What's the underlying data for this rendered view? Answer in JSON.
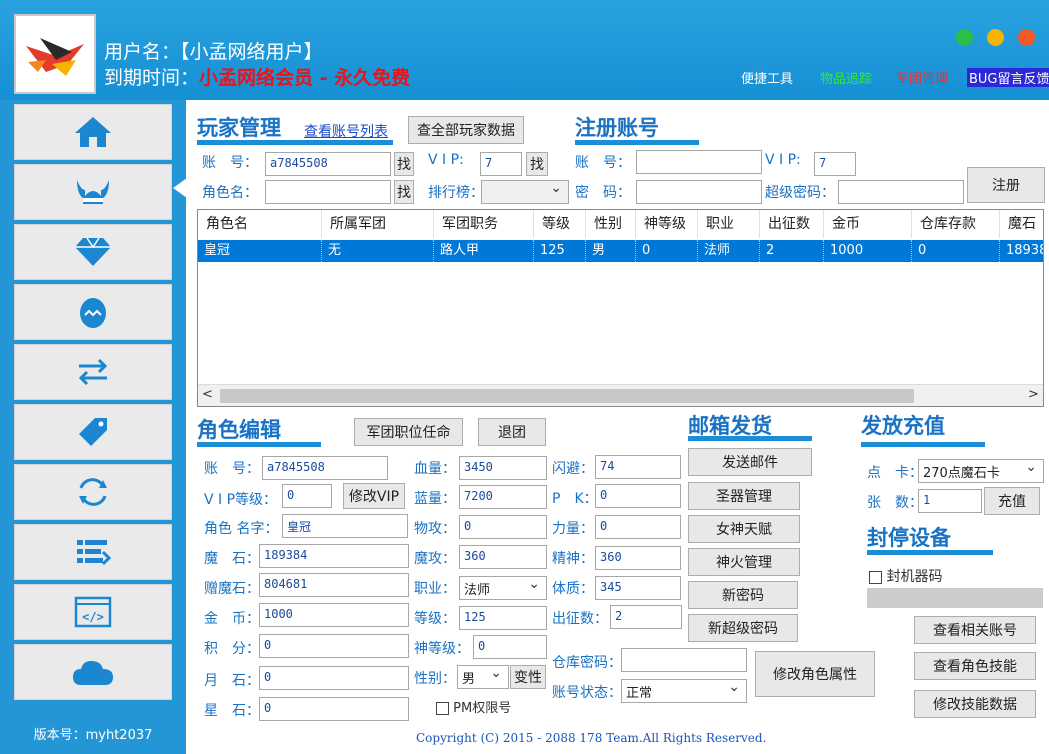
{
  "header": {
    "username_label": "用户名：",
    "username_value": "【小孟网络用户】",
    "expire_label": "到期时间：",
    "expire_value": "小孟网络会员 - 永久免费",
    "quick_links": [
      "便捷工具",
      "物品追踪",
      "军团管理",
      "BUG留言反馈"
    ],
    "dot_colors": [
      "#2bbf4a",
      "#f6b400",
      "#f05a28"
    ]
  },
  "sidebar": {
    "items": [
      "home-icon",
      "viking-helmet-icon",
      "diamond-icon",
      "egg-icon",
      "swap-arrows-icon",
      "tag-icon",
      "refresh-icon",
      "list-icon",
      "code-icon",
      "cloud-icon"
    ],
    "version": "版本号：myht2037"
  },
  "player": {
    "title": "玩家管理",
    "link": "查看账号列表",
    "all_button": "查全部玩家数据",
    "account_label": "账　号：",
    "account_value": "a7845508",
    "find_label": "找",
    "vip_label": "V I P:",
    "vip_value": "7",
    "role_label": "角色名：",
    "role_value": "",
    "rank_label": "排行榜：",
    "rank_value": ""
  },
  "register": {
    "title": "注册账号",
    "account_label": "账　号：",
    "account_value": "",
    "vip_label": "V I P:",
    "vip_value": "7",
    "password_label": "密　码：",
    "password_value": "",
    "super_label": "超级密码：",
    "super_value": "",
    "button": "注册"
  },
  "table": {
    "columns": [
      "角色名",
      "所属军团",
      "军团职务",
      "等级",
      "性别",
      "神等级",
      "职业",
      "出征数",
      "金币",
      "仓库存款",
      "魔石"
    ],
    "rows": [
      [
        "皇冠",
        "无",
        "路人甲",
        "125",
        "男",
        "0",
        "法师",
        "2",
        "1000",
        "0",
        "18938"
      ]
    ]
  },
  "editor": {
    "title": "角色编辑",
    "appoint_button": "军团职位任命",
    "quit_button": "退团",
    "account_label": "账　号：",
    "account_value": "a7845508",
    "vip_label": "V I P等级：",
    "vip_value": "0",
    "vip_button": "修改VIP",
    "name_label": "角色 名字：",
    "name_value": "皇冠",
    "stone_label": "魔　石：",
    "stone_value": "189384",
    "gift_label": "赠魔石：",
    "gift_value": "804681",
    "gold_label": "金　币：",
    "gold_value": "1000",
    "points_label": "积　分：",
    "points_value": "0",
    "moon_label": "月　石：",
    "moon_value": "0",
    "star_label": "星　石：",
    "star_value": "0",
    "hp_label": "血量：",
    "hp_value": "3450",
    "mp_label": "蓝量：",
    "mp_value": "7200",
    "atk_label": "物攻：",
    "atk_value": "0",
    "matk_label": "魔攻：",
    "matk_value": "360",
    "job_label": "职业：",
    "job_value": "法师",
    "level_label": "等级：",
    "level_value": "125",
    "god_label": "神等级：",
    "god_value": "0",
    "gender_label": "性别：",
    "gender_value": "男",
    "gender_button": "变性",
    "pm_label": "PM权限号",
    "dodge_label": "闪避：",
    "dodge_value": "74",
    "pk_label": "P　K：",
    "pk_value": "0",
    "str_label": "力量：",
    "str_value": "0",
    "spirit_label": "精神：",
    "spirit_value": "360",
    "con_label": "体质：",
    "con_value": "345",
    "expedition_label": "出征数：",
    "expedition_value": "2",
    "warehouse_label": "仓库密码：",
    "warehouse_value": "",
    "status_label": "账号状态：",
    "status_value": "正常",
    "modify_button": "修改角色属性"
  },
  "mail": {
    "title": "邮箱发货",
    "buttons": [
      "发送邮件",
      "圣器管理",
      "女神天赋",
      "神火管理",
      "新密码",
      "新超级密码"
    ]
  },
  "recharge": {
    "title": "发放充值",
    "card_label": "点　卡：",
    "card_value": "270点魔石卡",
    "count_label": "张　数：",
    "count_value": "1",
    "button": "充值"
  },
  "ban": {
    "title": "封停设备",
    "checkbox_label": "封机器码",
    "buttons": [
      "查看相关账号",
      "查看角色技能",
      "修改技能数据"
    ]
  },
  "copyright": "Copyright (C) 2015 - 2088 178 Team.All Rights Reserved."
}
